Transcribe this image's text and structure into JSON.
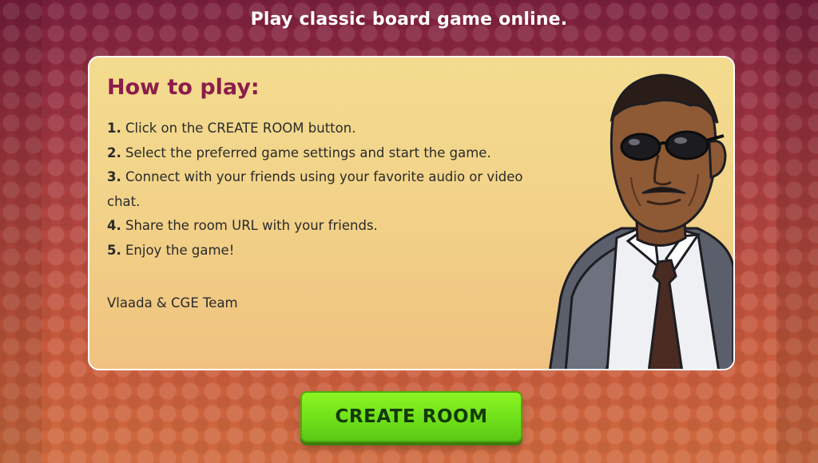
{
  "header": {
    "tagline": "Play classic board game online."
  },
  "how_to_play": {
    "title": "How to play:",
    "steps": [
      {
        "number": "1.",
        "text": "Click on the CREATE ROOM button."
      },
      {
        "number": "2.",
        "text": "Select the preferred game settings and start the game."
      },
      {
        "number": "3.",
        "text": "Connect with your friends using your favorite audio or video chat."
      },
      {
        "number": "4.",
        "text": "Share the room URL with your friends."
      },
      {
        "number": "5.",
        "text": "Enjoy the game!"
      }
    ],
    "signature": "Vlaada & CGE Team",
    "illustration": "agent-character-illustration"
  },
  "actions": {
    "create_room_label": "CREATE ROOM"
  },
  "colors": {
    "background_top": "#7a1f3d",
    "background_bottom": "#d06a3e",
    "card": "#f2d389",
    "title": "#8c1d4a",
    "button": "#6fe01a"
  }
}
